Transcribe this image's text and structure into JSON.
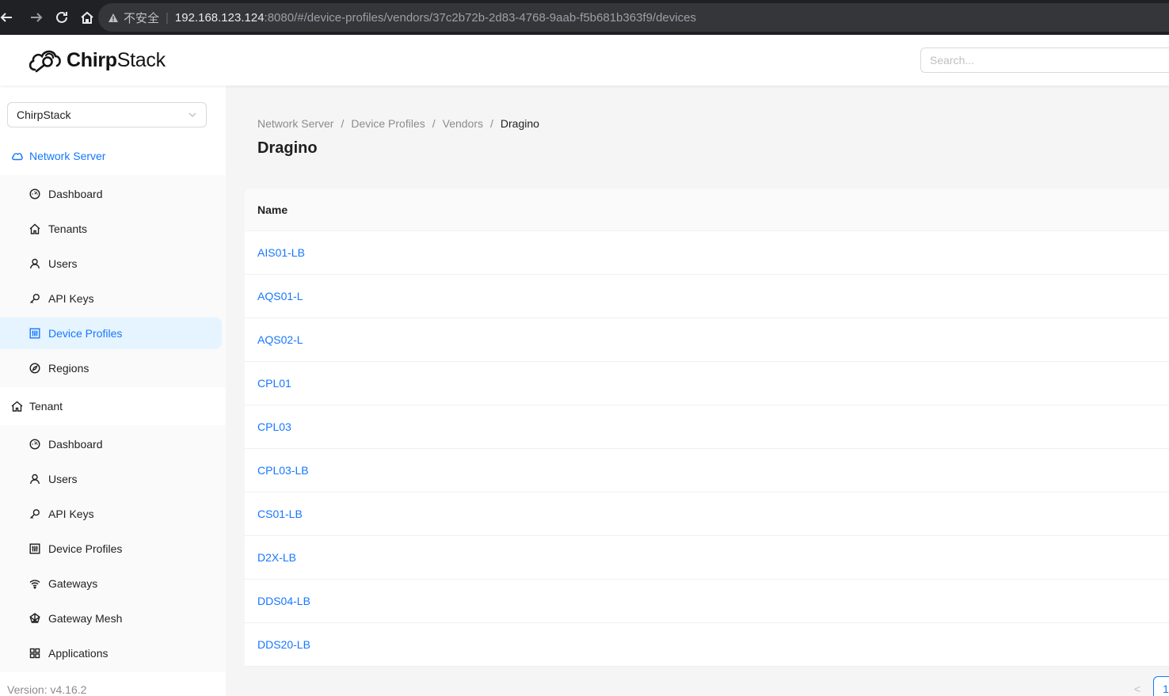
{
  "browser": {
    "insecure_label": "不安全",
    "url_host": "192.168.123.124",
    "url_rest": ":8080/#/device-profiles/vendors/37c2b72b-2d83-4768-9aab-f5b681b363f9/devices"
  },
  "header": {
    "logo_text_bold": "Chirp",
    "logo_text_rest": "Stack",
    "search_placeholder": "Search..."
  },
  "sidebar": {
    "tenant_selected": "ChirpStack",
    "network_server": {
      "label": "Network Server",
      "items": [
        {
          "label": "Dashboard",
          "icon": "dashboard-icon"
        },
        {
          "label": "Tenants",
          "icon": "home-icon"
        },
        {
          "label": "Users",
          "icon": "user-icon"
        },
        {
          "label": "API Keys",
          "icon": "key-icon"
        },
        {
          "label": "Device Profiles",
          "icon": "control-icon",
          "selected": true
        },
        {
          "label": "Regions",
          "icon": "compass-icon"
        }
      ]
    },
    "tenant": {
      "label": "Tenant",
      "items": [
        {
          "label": "Dashboard",
          "icon": "dashboard-icon"
        },
        {
          "label": "Users",
          "icon": "user-icon"
        },
        {
          "label": "API Keys",
          "icon": "key-icon"
        },
        {
          "label": "Device Profiles",
          "icon": "control-icon"
        },
        {
          "label": "Gateways",
          "icon": "wifi-icon"
        },
        {
          "label": "Gateway Mesh",
          "icon": "mesh-icon"
        },
        {
          "label": "Applications",
          "icon": "appstore-icon"
        }
      ]
    },
    "version": "Version: v4.16.2"
  },
  "main": {
    "breadcrumb": [
      "Network Server",
      "Device Profiles",
      "Vendors",
      "Dragino"
    ],
    "title": "Dragino",
    "table": {
      "column_name": "Name",
      "rows": [
        "AIS01-LB",
        "AQS01-L",
        "AQS02-L",
        "CPL01",
        "CPL03",
        "CPL03-LB",
        "CS01-LB",
        "D2X-LB",
        "DDS04-LB",
        "DDS20-LB"
      ]
    },
    "pagination": {
      "prev": "<",
      "current_page": "1"
    }
  },
  "colors": {
    "accent": "#1677ff",
    "selected_bg": "#e6f4ff",
    "browser_bar": "#202124"
  }
}
